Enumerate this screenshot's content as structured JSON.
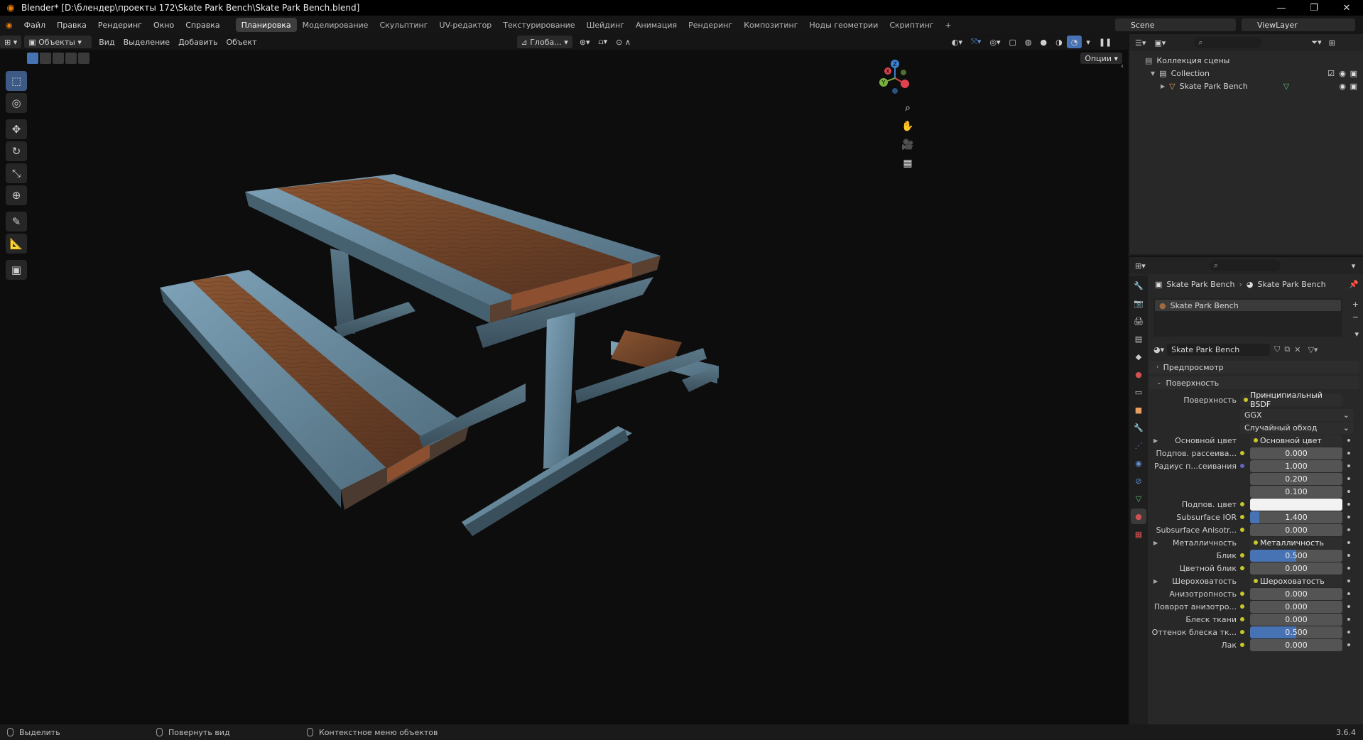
{
  "window": {
    "title": "Blender* [D:\\блендер\\проекты 172\\Skate Park Bench\\Skate Park Bench.blend]",
    "controls": [
      "minimize-icon",
      "restore-icon",
      "close-icon"
    ]
  },
  "menu": {
    "items": [
      "Файл",
      "Правка",
      "Рендеринг",
      "Окно",
      "Справка"
    ]
  },
  "workspaces": {
    "tabs": [
      "Планировка",
      "Моделирование",
      "Скульптинг",
      "UV-редактор",
      "Текстурирование",
      "Шейдинг",
      "Анимация",
      "Рендеринг",
      "Композитинг",
      "Ноды геометрии",
      "Скриптинг"
    ],
    "active": "Планировка",
    "add": "+"
  },
  "scene": {
    "name": "Scene",
    "viewlayer": "ViewLayer"
  },
  "viewport_header": {
    "mode": "Объекты",
    "menus": [
      "Вид",
      "Выделение",
      "Добавить",
      "Объект"
    ],
    "orientation": "Глоба...",
    "options": "Опции"
  },
  "gizmo": {
    "x": "X",
    "y": "Y",
    "z": "Z"
  },
  "outliner": {
    "root": "Коллекция сцены",
    "collection": "Collection",
    "object": "Skate Park Bench"
  },
  "properties": {
    "breadcrumb_object": "Skate Park Bench",
    "breadcrumb_material": "Skate Park Bench",
    "slot_name": "Skate Park Bench",
    "material_name": "Skate Park Bench",
    "panel_preview": "Предпросмотр",
    "panel_surface": "Поверхность",
    "surface_label": "Поверхность",
    "surface_value": "Принципиальный BSDF",
    "distribution": "GGX",
    "subsurface_method": "Случайный обход",
    "rows": [
      {
        "label": "Основной цвет",
        "type": "link",
        "value": "Основной цвет",
        "arrow": true
      },
      {
        "label": "Подпов. рассеива...",
        "type": "num",
        "value": "0.000"
      },
      {
        "label": "Радиус п...сеивания",
        "type": "num",
        "value": "1.000"
      },
      {
        "label": "",
        "type": "num",
        "value": "0.200"
      },
      {
        "label": "",
        "type": "num",
        "value": "0.100"
      },
      {
        "label": "Подпов. цвет",
        "type": "color",
        "value": "#f2f2f2"
      },
      {
        "label": "Subsurface IOR",
        "type": "num",
        "value": "1.400",
        "fill": 0.1
      },
      {
        "label": "Subsurface Anisotr...",
        "type": "num",
        "value": "0.000"
      },
      {
        "label": "Металличность",
        "type": "link",
        "value": "Металличность",
        "arrow": true
      },
      {
        "label": "Блик",
        "type": "num",
        "value": "0.500",
        "fill": 0.5
      },
      {
        "label": "Цветной блик",
        "type": "num",
        "value": "0.000"
      },
      {
        "label": "Шероховатость",
        "type": "link",
        "value": "Шероховатость",
        "arrow": true
      },
      {
        "label": "Анизотропность",
        "type": "num",
        "value": "0.000"
      },
      {
        "label": "Поворот анизотро...",
        "type": "num",
        "value": "0.000"
      },
      {
        "label": "Блеск ткани",
        "type": "num",
        "value": "0.000"
      },
      {
        "label": "Оттенок блеска тк...",
        "type": "num",
        "value": "0.500",
        "fill": 0.5
      },
      {
        "label": "Лак",
        "type": "num",
        "value": "0.000"
      }
    ]
  },
  "status": {
    "select": "Выделить",
    "rotate": "Повернуть вид",
    "context": "Контекстное меню объектов",
    "version": "3.6.4"
  },
  "colors": {
    "accent": "#4772b3",
    "blender_orange": "#e87d0d",
    "gizmo_x": "#e0434f",
    "gizmo_y": "#7ab23e",
    "gizmo_z": "#3c80cf"
  }
}
